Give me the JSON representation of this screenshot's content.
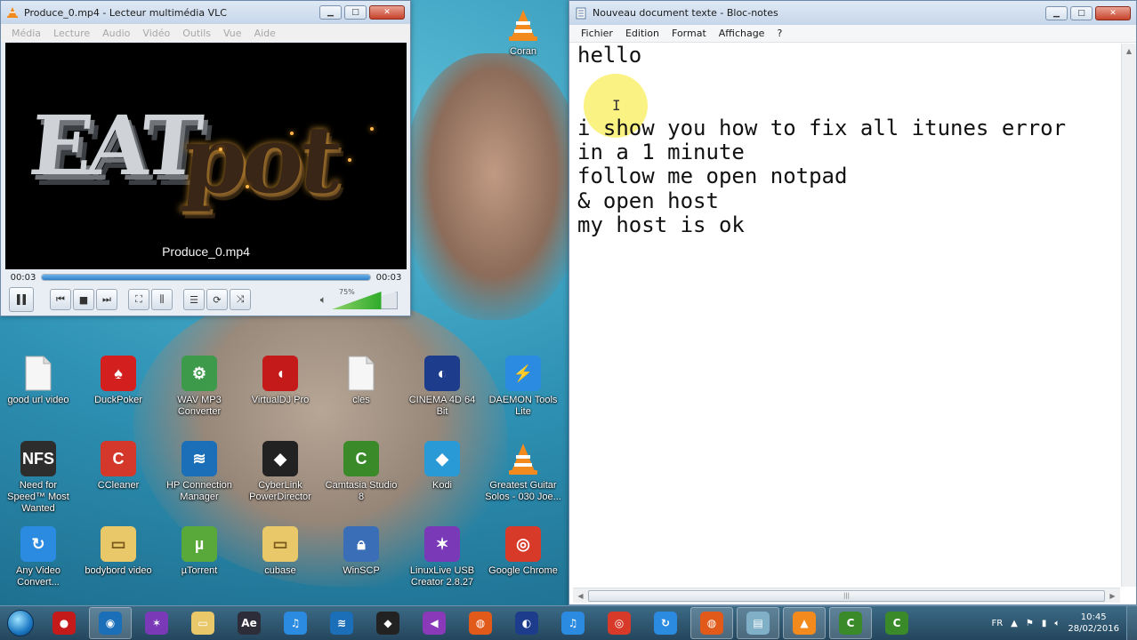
{
  "vlc": {
    "title": "Produce_0.mp4 - Lecteur multimédia VLC",
    "menu": [
      "Média",
      "Lecture",
      "Audio",
      "Vidéo",
      "Outils",
      "Vue",
      "Aide"
    ],
    "video_text_a": "EAT",
    "video_text_b": "pot",
    "video_caption": "Produce_0.mp4",
    "time_elapsed": "00:03",
    "time_total": "00:03",
    "seek_progress": 1.0,
    "volume_label": "75%",
    "volume_level": 0.75
  },
  "notepad": {
    "title": "Nouveau document texte - Bloc-notes",
    "menu": [
      "Fichier",
      "Edition",
      "Format",
      "Affichage",
      "?"
    ],
    "content": "hello\n\n\ni show you how to fix all itunes error\nin a 1 minute\nfollow me open notpad\n& open host\nmy host is ok"
  },
  "desktop_icons": [
    {
      "label": "Coran",
      "icon": "vlc-cone-icon",
      "color": "#f28a1d"
    },
    {
      "label": "good url video",
      "icon": "document-icon",
      "color": "#f4f4f4"
    },
    {
      "label": "DuckPoker",
      "icon": "duckpoker-icon",
      "color": "#d41f1f"
    },
    {
      "label": "WAV MP3 Converter",
      "icon": "gear-icon",
      "color": "#3c9a4a"
    },
    {
      "label": "VirtualDJ Pro",
      "icon": "virtualdj-icon",
      "color": "#c41a1a"
    },
    {
      "label": "cles",
      "icon": "document-icon",
      "color": "#f4f4f4"
    },
    {
      "label": "CINEMA 4D 64 Bit",
      "icon": "cinema4d-icon",
      "color": "#1d3d8c"
    },
    {
      "label": "DAEMON Tools Lite",
      "icon": "daemon-tools-icon",
      "color": "#2a8be0"
    },
    {
      "label": "Need for Speed™ Most Wanted",
      "icon": "nfs-icon",
      "color": "#2d2d2d"
    },
    {
      "label": "CCleaner",
      "icon": "ccleaner-icon",
      "color": "#d3382a"
    },
    {
      "label": "HP Connection Manager",
      "icon": "wifi-icon",
      "color": "#1a6fb8"
    },
    {
      "label": "CyberLink PowerDirector",
      "icon": "powerdirector-icon",
      "color": "#222222"
    },
    {
      "label": "Camtasia Studio 8",
      "icon": "camtasia-icon",
      "color": "#3a8a2a"
    },
    {
      "label": "Kodi",
      "icon": "kodi-icon",
      "color": "#2a9ad6"
    },
    {
      "label": "Greatest Guitar Solos - 030 Joe...",
      "icon": "vlc-cone-icon",
      "color": "#f28a1d"
    },
    {
      "label": "Any Video Convert...",
      "icon": "anyvideo-icon",
      "color": "#2a8be0"
    },
    {
      "label": "bodybord video",
      "icon": "folder-icon",
      "color": "#e9c86a"
    },
    {
      "label": "µTorrent",
      "icon": "utorrent-icon",
      "color": "#59a83a"
    },
    {
      "label": "cubase",
      "icon": "folder-icon",
      "color": "#e9c86a"
    },
    {
      "label": "WinSCP",
      "icon": "winscp-icon",
      "color": "#3a6fb8"
    },
    {
      "label": "LinuxLive USB Creator 2.8.27",
      "icon": "linuxlive-icon",
      "color": "#7a3ab8"
    },
    {
      "label": "Google Chrome",
      "icon": "chrome-icon",
      "color": "#d83a2a"
    }
  ],
  "taskbar": {
    "items": [
      {
        "icon": "red-app-icon",
        "color": "#c41a1a",
        "glyph": "●"
      },
      {
        "icon": "webcam-icon",
        "color": "#1a6fb8",
        "glyph": "◉"
      },
      {
        "icon": "linuxlive-icon",
        "color": "#7a3ab8",
        "glyph": "✶"
      },
      {
        "icon": "folder-icon",
        "color": "#e9c86a",
        "glyph": "▭"
      },
      {
        "icon": "after-effects-icon",
        "color": "#2d2d3a",
        "glyph": "Ae"
      },
      {
        "icon": "itunes-icon",
        "color": "#2a8be0",
        "glyph": "♫"
      },
      {
        "icon": "wifi-icon",
        "color": "#1a6fb8",
        "glyph": "≋"
      },
      {
        "icon": "powerdirector-icon",
        "color": "#222222",
        "glyph": "◆"
      },
      {
        "icon": "visual-studio-icon",
        "color": "#8a3ab8",
        "glyph": "◀"
      },
      {
        "icon": "firefox-icon",
        "color": "#e25a1a",
        "glyph": "◍"
      },
      {
        "icon": "cinema4d-icon",
        "color": "#1d3d8c",
        "glyph": "◐"
      },
      {
        "icon": "itunes-icon",
        "color": "#2a8be0",
        "glyph": "♫"
      },
      {
        "icon": "chrome-icon",
        "color": "#d83a2a",
        "glyph": "◎"
      },
      {
        "icon": "anyvideo-icon",
        "color": "#2a8be0",
        "glyph": "↻"
      },
      {
        "icon": "firefox-icon",
        "color": "#e25a1a",
        "glyph": "◍"
      },
      {
        "icon": "notepad-icon",
        "color": "#7fb0c8",
        "glyph": "▤"
      },
      {
        "icon": "vlc-cone-icon",
        "color": "#f28a1d",
        "glyph": "▲"
      },
      {
        "icon": "camtasia-icon",
        "color": "#3a8a2a",
        "glyph": "C"
      },
      {
        "icon": "camtasia-icon",
        "color": "#3a8a2a",
        "glyph": "C"
      }
    ],
    "language": "FR",
    "time": "10:45",
    "date": "28/02/2016"
  }
}
